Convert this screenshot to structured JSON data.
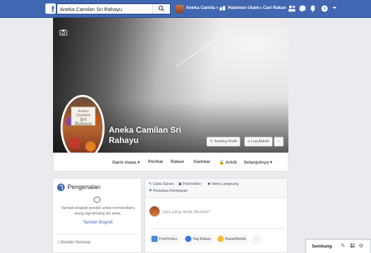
{
  "topbar": {
    "logo": "f",
    "search_value": "Aneka Camilan Sri Rahayu",
    "nav_profile": "Aneka Camilan",
    "nav_home": "Halaman Utama",
    "nav_find_friends": "Cari Rakan",
    "icons": [
      "friends-icon",
      "messenger-icon",
      "bell-icon",
      "help-icon",
      "dropdown-icon"
    ]
  },
  "page": {
    "name_line1": "Aneka Camilan Sri",
    "name_line2": "Rahayu",
    "edit_profile": "Sunting Profil",
    "activity_log": "Log Aktiviti",
    "more": "···",
    "profile_card_line1": "Aneka Camilan",
    "profile_card_line2": "Sri Rahayu"
  },
  "tabs": [
    {
      "label": "Garis masa ▾"
    },
    {
      "label": "Perihal"
    },
    {
      "label": "Rakan"
    },
    {
      "label": "Gambar"
    },
    {
      "label": "Arkib"
    },
    {
      "label": "Selanjutnya ▾"
    }
  ],
  "intro": {
    "title": "Pengenalan",
    "text": "Tambah biografi pendek untuk memberitahu orang lagi tentang diri anda.",
    "link": "Tambah Biografi",
    "row": "Bandar Semasa"
  },
  "composer": {
    "create_post": "Cipta Siaran",
    "photo_video": "Foto/Video",
    "live_video": "Video Langsung",
    "life_event": "Peristiwa Kehidupan",
    "placeholder": "Apa yang anda fikirkan?",
    "pill_photo": "Foto/Video",
    "pill_tag": "Tag Rakan",
    "pill_feeling": "Rasa/Aktiviti",
    "pill_more": "···"
  },
  "chat": {
    "label": "Sembang"
  }
}
